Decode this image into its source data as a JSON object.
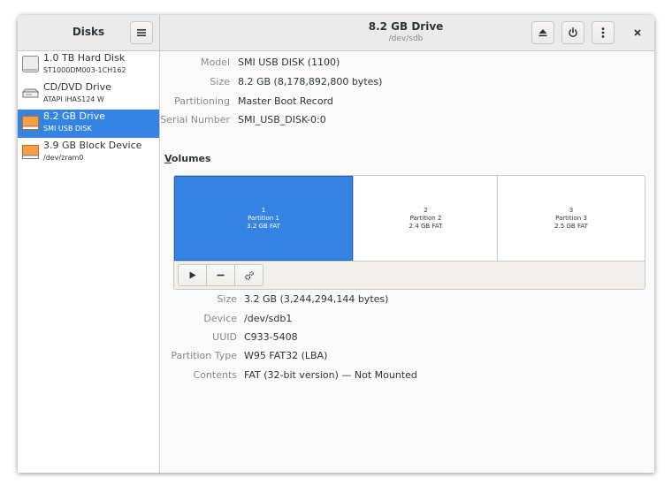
{
  "header": {
    "app_title": "Disks",
    "drive_title": "8.2 GB Drive",
    "drive_subtitle": "/dev/sdb"
  },
  "sidebar": {
    "drives": [
      {
        "name": "1.0 TB Hard Disk",
        "model": "ST1000DM003-1CH162",
        "icon": "hard-disk-icon",
        "selected": false
      },
      {
        "name": "CD/DVD Drive",
        "model": "ATAPI  iHAS124  W",
        "icon": "optical-drive-icon",
        "selected": false
      },
      {
        "name": "8.2 GB Drive",
        "model": "SMI USB DISK",
        "icon": "usb-drive-icon",
        "selected": true
      },
      {
        "name": "3.9 GB Block Device",
        "model": "/dev/zram0",
        "icon": "block-device-icon",
        "selected": false
      }
    ]
  },
  "drive_info": {
    "model_label": "Model",
    "model_value": "SMI USB DISK (1100)",
    "size_label": "Size",
    "size_value": "8.2 GB (8,178,892,800 bytes)",
    "partitioning_label": "Partitioning",
    "partitioning_value": "Master Boot Record",
    "serial_label": "Serial Number",
    "serial_value": "SMI_USB_DISK-0:0"
  },
  "volumes": {
    "heading_first": "V",
    "heading_rest": "olumes",
    "partitions": [
      {
        "number": "1",
        "name": "Partition 1",
        "desc": "3.2 GB FAT",
        "selected": true
      },
      {
        "number": "2",
        "name": "Partition 2",
        "desc": "2.4 GB FAT",
        "selected": false
      },
      {
        "number": "3",
        "name": "Partition 3",
        "desc": "2.5 GB FAT",
        "selected": false
      }
    ]
  },
  "partition_info": {
    "size_label": "Size",
    "size_value": "3.2 GB (3,244,294,144 bytes)",
    "device_label": "Device",
    "device_value": "/dev/sdb1",
    "uuid_label": "UUID",
    "uuid_value": "C933-5408",
    "type_label": "Partition Type",
    "type_value": "W95 FAT32 (LBA)",
    "contents_label": "Contents",
    "contents_value": "FAT (32-bit version) — Not Mounted"
  },
  "colors": {
    "accent": "#3584e4",
    "header_bg": "#ebebeb",
    "label": "#888a85"
  }
}
